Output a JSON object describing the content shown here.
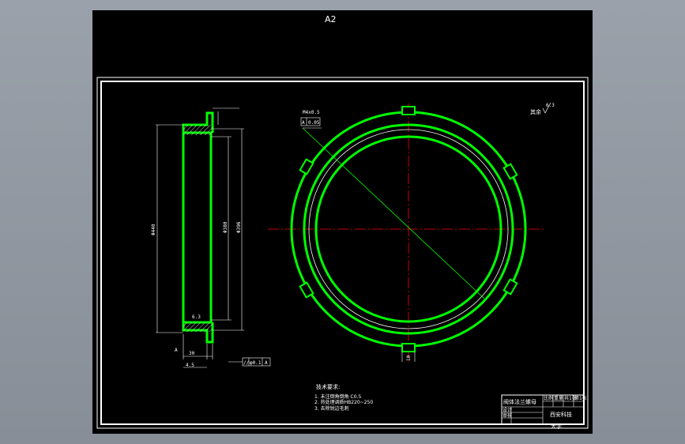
{
  "sheet": {
    "title": "A2"
  },
  "drawing": {
    "roughness_symbol": "其余",
    "roughness_value": "6.3",
    "section_label": "A",
    "datum_label": "A",
    "tolerance_frame": {
      "symbol": "//",
      "value": "φ0.1",
      "datum": "A"
    },
    "flatness_frame": {
      "value": "0.05",
      "datum": "A"
    },
    "leader_label": "M4x0.5",
    "dim_side_left": "Φ440",
    "dim_side_inner": "Φ380",
    "dim_side_right": "Φ396",
    "dim_bottom": "30",
    "dim_bottom_small": "4.5",
    "dim_slot": "10"
  },
  "notes": {
    "heading": "技术要求:",
    "items": [
      "1. 未注倒角倒角 C0.5",
      "2. 热处理调质HB220~250",
      "3. 去除锐边毛刺"
    ]
  },
  "title_block": {
    "part_name": "阀体法兰螺母",
    "col1": "比例",
    "col2": "重量",
    "col3": "共1张",
    "col4": "第1张",
    "row2_left": "设计",
    "row3_left": "审核",
    "school": "西安科技",
    "university": "大学"
  },
  "colors": {
    "background": "#000000",
    "geometry": "#00ff00",
    "centerline": "#ff0000",
    "text": "#ffffff",
    "leader": "#00ff00",
    "hatch": "#ffffff",
    "dim": "#ffffff"
  }
}
